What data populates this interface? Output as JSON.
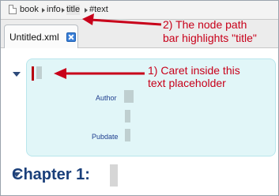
{
  "pathbar": {
    "icon": "document-icon",
    "crumbs": [
      "book",
      "info",
      "title",
      "#text"
    ],
    "highlighted": "title"
  },
  "tab": {
    "label": "Untitled.xml",
    "close_icon": "close-icon"
  },
  "editor": {
    "info_fields": [
      "Author",
      "Pubdate"
    ],
    "chapter_heading": "Chapter 1:"
  },
  "annotations": {
    "pathbar_note_line1": "2) The node path",
    "pathbar_note_line2": "bar highlights \"title\"",
    "caret_note_line1": "1) Caret inside this",
    "caret_note_line2": "text placeholder"
  },
  "colors": {
    "annotation": "#c8001a",
    "info_box": "#e1f6f8",
    "heading": "#1a3f7a",
    "field_label": "#1f3f8f"
  }
}
